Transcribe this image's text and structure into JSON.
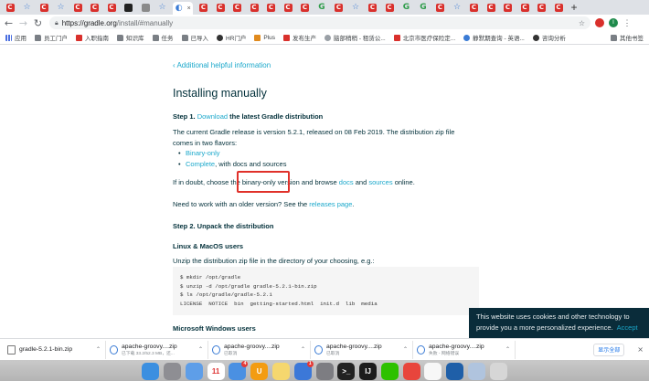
{
  "browser": {
    "tabs_favicons": [
      "red",
      "blue",
      "red",
      "blue",
      "red",
      "red",
      "red",
      "dark",
      "ghost",
      "blue",
      "active",
      "red",
      "red",
      "red",
      "red",
      "red",
      "red",
      "red",
      "green",
      "red",
      "blue",
      "red",
      "red",
      "green",
      "green",
      "red",
      "blue",
      "red",
      "red",
      "red",
      "red",
      "red",
      "red"
    ],
    "active_tab_close": "×",
    "new_tab": "+",
    "url_host": "https://gradle.org",
    "url_path": "/install/#manually",
    "profile_initial": "I"
  },
  "bookmarks": [
    {
      "label": "应用",
      "icon": "grid"
    },
    {
      "label": "员工门户",
      "icon": "folder"
    },
    {
      "label": "入职指南",
      "icon": "red"
    },
    {
      "label": "知识库",
      "icon": "folder"
    },
    {
      "label": "任务",
      "icon": "folder"
    },
    {
      "label": "已导入",
      "icon": "folder"
    },
    {
      "label": "HR门户",
      "icon": "dark"
    },
    {
      "label": "Plus",
      "icon": "orange"
    },
    {
      "label": "发布生产",
      "icon": "red"
    },
    {
      "label": "脑部稍稍 - 租赁公...",
      "icon": "gray"
    },
    {
      "label": "北京市医疗保险定...",
      "icon": "red"
    },
    {
      "label": "静默期查询 - 英语...",
      "icon": "blue"
    },
    {
      "label": "咨询分析",
      "icon": "dark"
    }
  ],
  "bookmarks_more": "其他书签",
  "page": {
    "back_link": "‹ Additional helpful information",
    "title": "Installing manually",
    "step1_prefix": "Step 1.",
    "step1_link": "Download",
    "step1_suffix": "the latest Gradle distribution",
    "intro_line1": "The current Gradle release is version 5.2.1, released on 08 Feb 2019. The distribution zip file",
    "intro_line2": "comes in two flavors:",
    "flavor1_link": "Binary-only",
    "flavor2_link": "Complete",
    "flavor2_suffix": ", with docs and sources",
    "doubt_prefix": "If in doubt, choose the binary-only version and browse",
    "doubt_docs": "docs",
    "doubt_and": "and",
    "doubt_sources": "sources",
    "doubt_suffix": "online.",
    "older_prefix": "Need to work with an older version? See the",
    "older_link": "releases page",
    "older_suffix": ".",
    "step2": "Step 2. Unpack the distribution",
    "linux_heading": "Linux & MacOS users",
    "unzip_text": "Unzip the distribution zip file in the directory of your choosing, e.g.:",
    "code_lines": [
      "$ mkdir /opt/gradle",
      "$ unzip -d /opt/gradle gradle-5.2.1-bin.zip",
      "$ ls /opt/gradle/gradle-5.2.1",
      "LICENSE  NOTICE  bin  getting-started.html  init.d  lib  media"
    ],
    "windows_heading": "Microsoft Windows users"
  },
  "cookie": {
    "line1": "This website uses cookies and other technology to",
    "line2": "provide you a more personalized experience.",
    "accept": "Accept"
  },
  "downloads": {
    "items": [
      {
        "name": "gradle-5.2.1-bin.zip",
        "sub": ""
      },
      {
        "name": "apache-groovy....zip",
        "sub": "已下载 33.2/52.3 MB，还..."
      },
      {
        "name": "apache-groovy....zip",
        "sub": "已取消"
      },
      {
        "name": "apache-groovy....zip",
        "sub": "已取消"
      },
      {
        "name": "apache-groovy....zip",
        "sub": "失败 - 网络错误"
      }
    ],
    "show_all": "显示全部",
    "close": "×"
  },
  "dock": {
    "apps": [
      {
        "name": "finder",
        "color": "#3b8fe0",
        "label": ""
      },
      {
        "name": "launchpad",
        "color": "#8e8e93",
        "label": ""
      },
      {
        "name": "safari",
        "color": "#5e9ee8",
        "label": ""
      },
      {
        "name": "calendar",
        "color": "#ffffff",
        "label": "11"
      },
      {
        "name": "qq-browser",
        "color": "#4a90e2",
        "label": ""
      },
      {
        "name": "ultraedit",
        "color": "#f39c12",
        "label": "U"
      },
      {
        "name": "notes",
        "color": "#f5d76e",
        "label": ""
      },
      {
        "name": "mindnode",
        "color": "#3c78d8",
        "label": ""
      },
      {
        "name": "system-prefs",
        "color": "#7d7d82",
        "label": ""
      },
      {
        "name": "terminal",
        "color": "#222222",
        "label": ">_"
      },
      {
        "name": "intellij",
        "color": "#1c1c1c",
        "label": "IJ"
      },
      {
        "name": "wechat",
        "color": "#2dc100",
        "label": ""
      },
      {
        "name": "chrome",
        "color": "#e8453c",
        "label": ""
      },
      {
        "name": "qq",
        "color": "#f7f7f7",
        "label": ""
      },
      {
        "name": "virtualbox",
        "color": "#1f5fa8",
        "label": ""
      },
      {
        "name": "preview",
        "color": "#b0c4de",
        "label": ""
      },
      {
        "name": "trash",
        "color": "#d6d6d6",
        "label": ""
      }
    ],
    "calendar_badge": "4",
    "mindnode_badge": "1"
  }
}
